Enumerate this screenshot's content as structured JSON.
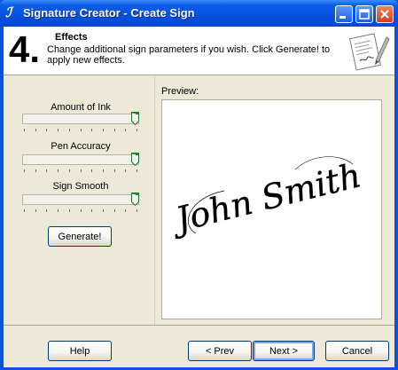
{
  "window": {
    "title": "Signature Creator - Create Sign"
  },
  "header": {
    "step_number": "4.",
    "step_title": "Effects",
    "step_description": "Change additional sign parameters if you wish. Click Generate! to apply new effects."
  },
  "effects": {
    "ink_label": "Amount of Ink",
    "ink_level": 1.0,
    "accuracy_label": "Pen Accuracy",
    "accuracy_level": 1.0,
    "smooth_label": "Sign Smooth",
    "smooth_level": 1.0,
    "generate_label": "Generate!"
  },
  "preview": {
    "label": "Preview:",
    "signature_text": "John Smith"
  },
  "footer": {
    "help_label": "Help",
    "prev_label": "< Prev",
    "next_label": "Next >",
    "cancel_label": "Cancel"
  },
  "colors": {
    "titlebar": "#0651DE",
    "dialog_bg": "#ECE9D8",
    "button_border": "#003C74"
  },
  "icons": {
    "app": "signature-script-icon",
    "header": "document-check-icon"
  }
}
